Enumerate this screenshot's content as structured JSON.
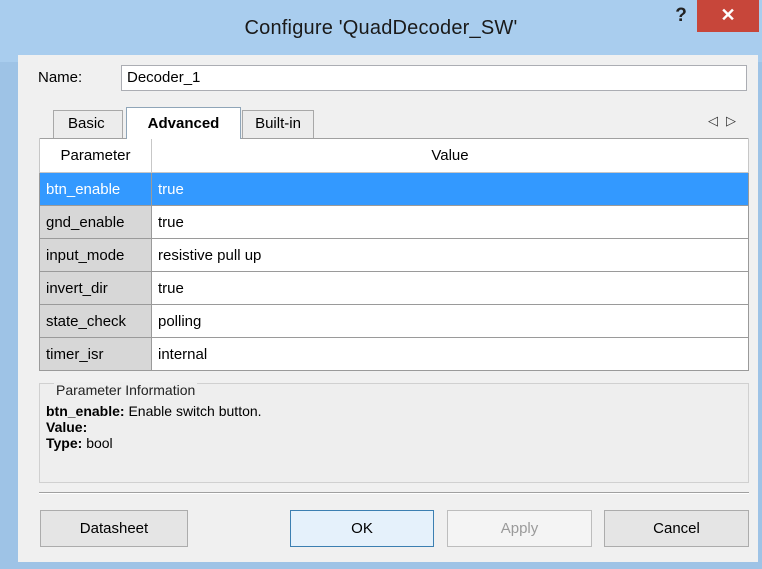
{
  "window": {
    "title": "Configure 'QuadDecoder_SW'",
    "help_label": "?",
    "close_label": "✕"
  },
  "name_field": {
    "label": "Name:",
    "value": "Decoder_1"
  },
  "tabs": [
    {
      "label": "Basic",
      "active": false
    },
    {
      "label": "Advanced",
      "active": true
    },
    {
      "label": "Built-in",
      "active": false
    }
  ],
  "tab_scroll": {
    "left": "◁",
    "right": "▷"
  },
  "grid": {
    "columns": [
      "Parameter",
      "Value"
    ],
    "rows": [
      {
        "param": "btn_enable",
        "value": "true",
        "selected": true
      },
      {
        "param": "gnd_enable",
        "value": "true",
        "selected": false
      },
      {
        "param": "input_mode",
        "value": "resistive pull up",
        "selected": false
      },
      {
        "param": "invert_dir",
        "value": "true",
        "selected": false
      },
      {
        "param": "state_check",
        "value": "polling",
        "selected": false
      },
      {
        "param": "timer_isr",
        "value": "internal",
        "selected": false
      }
    ]
  },
  "info": {
    "title": "Parameter Information",
    "param_name": "btn_enable:",
    "description": " Enable switch button.",
    "value_label": "Value:",
    "value_text": "",
    "type_label": "Type:",
    "type_text": " bool"
  },
  "buttons": {
    "datasheet": "Datasheet",
    "ok": "OK",
    "apply": "Apply",
    "cancel": "Cancel"
  },
  "colors": {
    "titlebar": "#a9cdee",
    "close": "#c7463a",
    "selection": "#3399ff"
  }
}
